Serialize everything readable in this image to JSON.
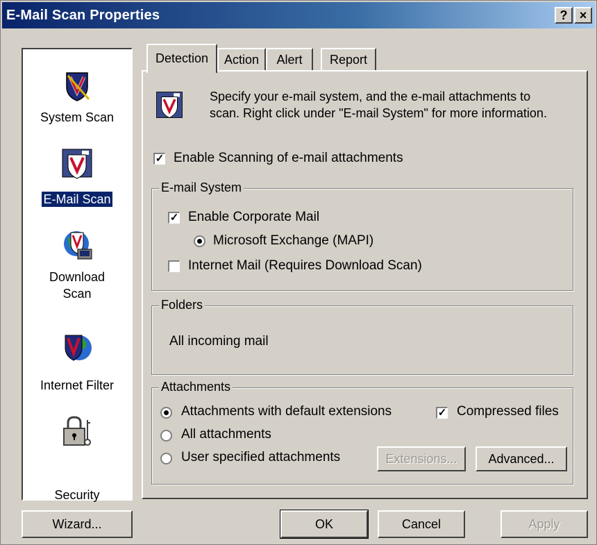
{
  "window": {
    "title": "E-Mail Scan Properties",
    "help_glyph": "?",
    "close_glyph": "×"
  },
  "sidebar": {
    "items": [
      {
        "label": "System Scan",
        "icon": "shield-sword-icon"
      },
      {
        "label": "E-Mail Scan",
        "icon": "email-shield-icon",
        "selected": true
      },
      {
        "label": "Download Scan",
        "label_line1": "Download",
        "label_line2": "Scan",
        "icon": "download-shield-icon"
      },
      {
        "label": "Internet Filter",
        "icon": "globe-shield-icon"
      },
      {
        "label": "Security",
        "icon": "padlock-key-icon"
      }
    ]
  },
  "tabs": [
    {
      "label": "Detection",
      "active": true
    },
    {
      "label": "Action"
    },
    {
      "label": "Alert"
    },
    {
      "label": "Report"
    }
  ],
  "detection": {
    "description_line1": "Specify your e-mail system, and the e-mail attachments to",
    "description_line2": "scan. Right click under \"E-mail System\" for more information.",
    "enable_scanning": {
      "label": "Enable Scanning of e-mail attachments",
      "checked": true
    },
    "email_system": {
      "title": "E-mail System",
      "corporate": {
        "label": "Enable Corporate Mail",
        "checked": true
      },
      "exchange": {
        "label": "Microsoft Exchange (MAPI)",
        "selected": true
      },
      "internet": {
        "label": "Internet Mail (Requires Download Scan)",
        "checked": false
      }
    },
    "folders": {
      "title": "Folders",
      "value": "All incoming mail"
    },
    "attachments": {
      "title": "Attachments",
      "options": [
        {
          "label": "Attachments with default extensions",
          "selected": true
        },
        {
          "label": "All attachments",
          "selected": false
        },
        {
          "label": "User specified attachments",
          "selected": false
        }
      ],
      "compressed": {
        "label": "Compressed files",
        "checked": true
      },
      "extensions_button": "Extensions...",
      "advanced_button": "Advanced..."
    }
  },
  "footer": {
    "wizard": "Wizard...",
    "ok": "OK",
    "cancel": "Cancel",
    "apply": "Apply"
  },
  "colors": {
    "titlebar": "#0a246a",
    "face": "#d4d0c8",
    "selection": "#0a246a"
  }
}
